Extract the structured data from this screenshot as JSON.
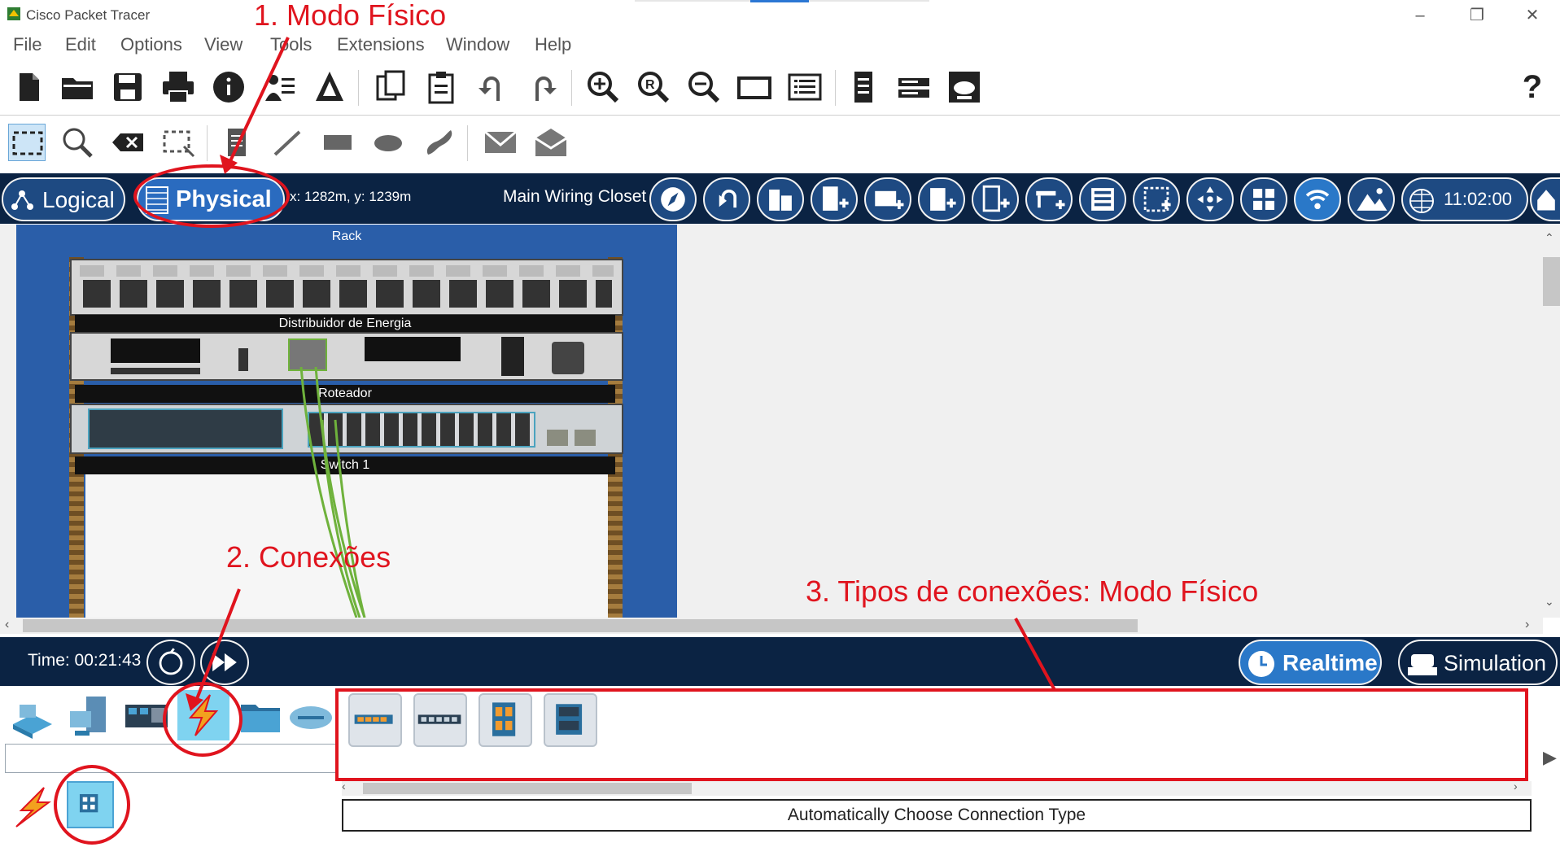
{
  "window": {
    "title": "Cisco Packet Tracer",
    "controls": [
      "–",
      "❐",
      "✕"
    ]
  },
  "menu": [
    "File",
    "Edit",
    "Options",
    "View",
    "Tools",
    "Extensions",
    "Window",
    "Help"
  ],
  "toolbar_main": {
    "icons": [
      "new-file-icon",
      "open-folder-icon",
      "save-icon",
      "print-icon",
      "info-icon",
      "activity-wizard-icon",
      "pdu-icon",
      "copy-icon",
      "paste-icon",
      "undo-icon",
      "redo-icon",
      "zoom-in-icon",
      "zoom-reset-icon",
      "zoom-out-icon",
      "drawing-palette-icon",
      "custom-device-dialog-icon",
      "viewport-icon",
      "network-information-icon",
      "cluster-icon"
    ],
    "help_label": "?"
  },
  "toolbar_secondary": {
    "icons": [
      "select-icon",
      "inspect-icon",
      "delete-icon",
      "resize-shape-icon",
      "place-note-icon",
      "draw-line-icon",
      "draw-rectangle-icon",
      "draw-ellipse-icon",
      "draw-freeform-icon",
      "add-simple-pdu-icon",
      "add-complex-pdu-icon"
    ]
  },
  "navbar": {
    "logical_label": "Logical",
    "physical_label": "Physical",
    "coords": "x: 1282m, y: 1239m",
    "location": "Main Wiring Closet",
    "clock": "11:02:00"
  },
  "rack": {
    "title": "Rack",
    "devices": [
      {
        "label": "Distribuidor de Energia"
      },
      {
        "label": "Roteador"
      },
      {
        "label": "Switch 1"
      }
    ]
  },
  "timebar": {
    "time": "Time: 00:21:43",
    "realtime_label": "Realtime",
    "simulation_label": "Simulation"
  },
  "device_panel": {
    "search_value": "",
    "selected_category": "Connections",
    "status_text": "Automatically Choose Connection Type"
  },
  "annotations": {
    "a1": "1. Modo Físico",
    "a2": "2. Conexões",
    "a3": "3. Tipos de conexões: Modo Físico"
  },
  "colors": {
    "navbar": "#0b2343",
    "button_blue": "#1e4a82",
    "annotation_red": "#e0141e",
    "rack_blue": "#2a5ea9",
    "cable_green": "#6fb23c"
  }
}
